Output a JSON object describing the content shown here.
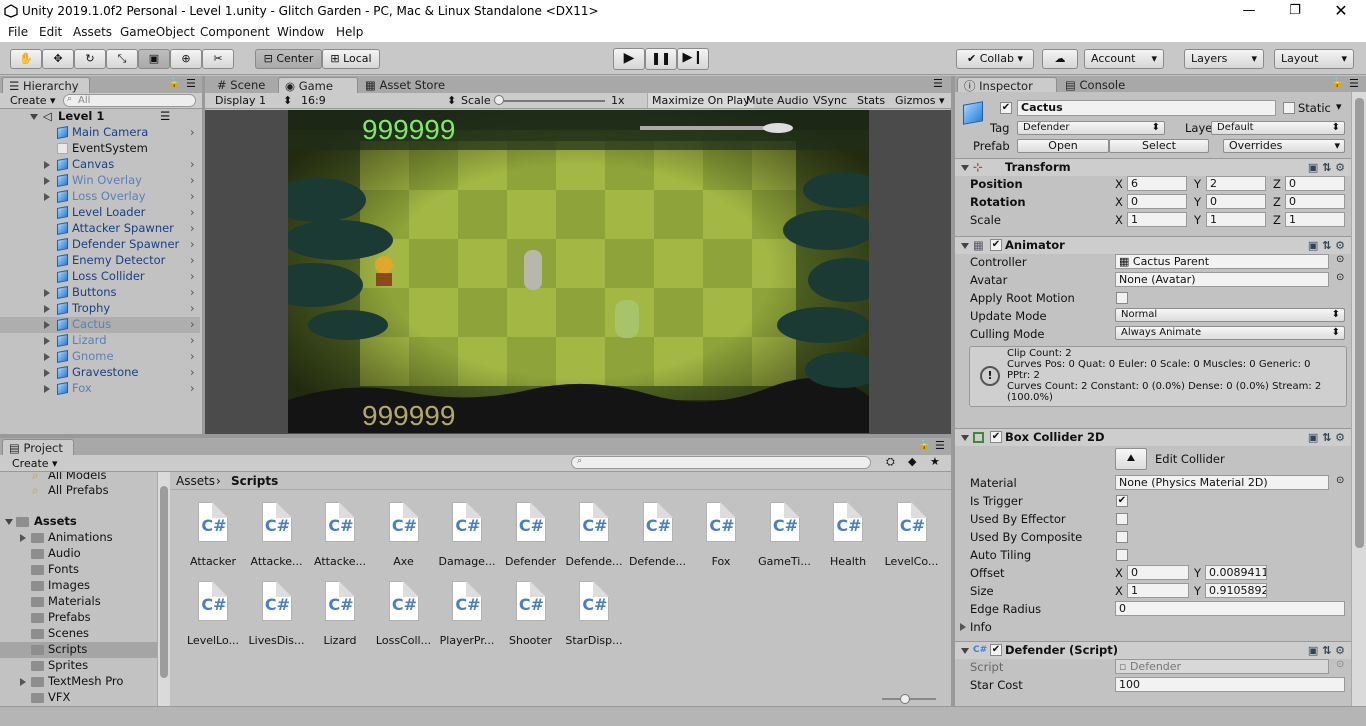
{
  "window": {
    "title": "Unity 2019.1.0f2 Personal - Level 1.unity - Glitch Garden - PC, Mac & Linux Standalone <DX11>"
  },
  "menu": [
    "File",
    "Edit",
    "Assets",
    "GameObject",
    "Component",
    "Window",
    "Help"
  ],
  "toolbar": {
    "center": "Center",
    "local": "Local",
    "collab": "Collab",
    "account": "Account",
    "layers": "Layers",
    "layout": "Layout"
  },
  "hierarchy": {
    "tab": "Hierarchy",
    "create": "Create",
    "search": "All",
    "scene": "Level 1",
    "items": [
      {
        "label": "Main Camera",
        "expand": false
      },
      {
        "label": "EventSystem",
        "expand": false
      },
      {
        "label": "Canvas",
        "expand": true
      },
      {
        "label": "Win Overlay",
        "expand": true
      },
      {
        "label": "Loss Overlay",
        "expand": true
      },
      {
        "label": "Level Loader",
        "expand": false
      },
      {
        "label": "Attacker Spawner",
        "expand": false
      },
      {
        "label": "Defender Spawner",
        "expand": false
      },
      {
        "label": "Enemy Detector",
        "expand": false
      },
      {
        "label": "Loss Collider",
        "expand": false
      },
      {
        "label": "Buttons",
        "expand": true
      },
      {
        "label": "Trophy",
        "expand": true
      },
      {
        "label": "Cactus",
        "expand": true
      },
      {
        "label": "Lizard",
        "expand": true
      },
      {
        "label": "Gnome",
        "expand": true
      },
      {
        "label": "Gravestone",
        "expand": true
      },
      {
        "label": "Fox",
        "expand": true
      }
    ]
  },
  "center_tabs": {
    "scene": "Scene",
    "game": "Game",
    "store": "Asset Store"
  },
  "game_toolbar": {
    "display": "Display 1",
    "aspect": "16:9",
    "scale_label": "Scale",
    "scale_value": "1x",
    "maximize": "Maximize On Play",
    "mute": "Mute Audio",
    "vsync": "VSync",
    "stats": "Stats",
    "gizmos": "Gizmos"
  },
  "game_view": {
    "score_top": "999999",
    "score_bottom": "999999"
  },
  "project": {
    "tab": "Project",
    "create": "Create",
    "favorites": [
      "All Models",
      "All Prefabs"
    ],
    "assets_root": "Assets",
    "folders": [
      "Animations",
      "Audio",
      "Fonts",
      "Images",
      "Materials",
      "Prefabs",
      "Scenes",
      "Scripts",
      "Sprites",
      "TextMesh Pro",
      "VFX"
    ],
    "breadcrumb": [
      "Assets",
      "Scripts"
    ],
    "files": [
      "Attacker",
      "Attacke...",
      "Attacke...",
      "Axe",
      "Damage...",
      "Defender",
      "Defende...",
      "Defende...",
      "Fox",
      "GameTi...",
      "Health",
      "LevelCo...",
      "LevelLo...",
      "LivesDis...",
      "Lizard",
      "LossColl...",
      "PlayerPr...",
      "Shooter",
      "StarDisp..."
    ],
    "file_glyph": "C#"
  },
  "right_tabs": {
    "inspector": "Inspector",
    "console": "Console"
  },
  "inspector": {
    "name": "Cactus",
    "static": "Static",
    "tag_label": "Tag",
    "tag": "Defender",
    "layer_label": "Layer",
    "layer": "Default",
    "prefab_label": "Prefab",
    "open": "Open",
    "select": "Select",
    "overrides": "Overrides",
    "transform": {
      "title": "Transform",
      "position": "Position",
      "rotation": "Rotation",
      "scale": "Scale",
      "pos": [
        "6",
        "2",
        "0"
      ],
      "rot": [
        "0",
        "0",
        "0"
      ],
      "scl": [
        "1",
        "1",
        "1"
      ]
    },
    "animator": {
      "title": "Animator",
      "controller_label": "Controller",
      "controller": "Cactus Parent",
      "avatar_label": "Avatar",
      "avatar": "None (Avatar)",
      "root_motion": "Apply Root Motion",
      "update_label": "Update Mode",
      "update": "Normal",
      "culling_label": "Culling Mode",
      "culling": "Always Animate",
      "info_lines": [
        "Clip Count: 2",
        "Curves Pos: 0 Quat: 0 Euler: 0 Scale: 0 Muscles: 0 Generic: 0",
        "PPtr: 2",
        "Curves Count: 2 Constant: 0 (0.0%) Dense: 0 (0.0%) Stream: 2",
        "(100.0%)"
      ]
    },
    "box": {
      "title": "Box Collider 2D",
      "edit": "Edit Collider",
      "material_label": "Material",
      "material": "None (Physics Material 2D)",
      "trigger": "Is Trigger",
      "effector": "Used By Effector",
      "composite": "Used By Composite",
      "tiling": "Auto Tiling",
      "offset_label": "Offset",
      "offset": [
        "0",
        "0.0089411"
      ],
      "size_label": "Size",
      "size": [
        "1",
        "0.9105892"
      ],
      "edge_label": "Edge Radius",
      "edge": "0",
      "info": "Info"
    },
    "script": {
      "title": "Defender (Script)",
      "script_label": "Script",
      "script": "Defender",
      "cost_label": "Star Cost",
      "cost": "100"
    }
  },
  "axes": {
    "x": "X",
    "y": "Y",
    "z": "Z"
  }
}
